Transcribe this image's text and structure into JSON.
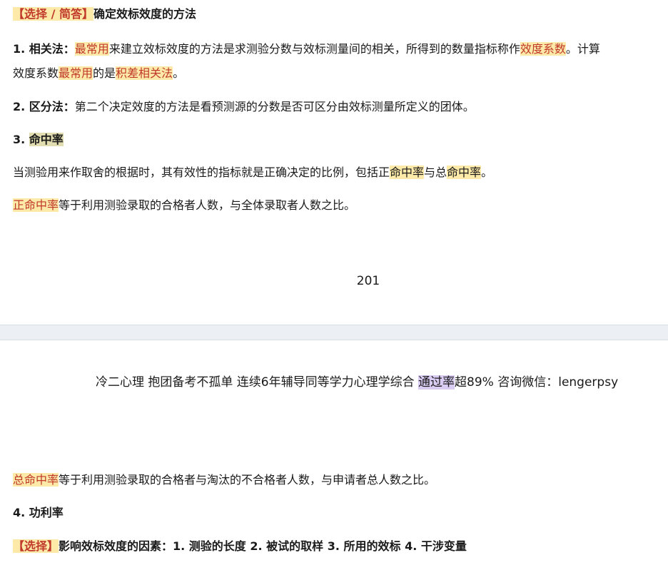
{
  "page1": {
    "line1": {
      "tag": "【选择 / 简答】",
      "title": "确定效标效度的方法"
    },
    "line2": {
      "num": "1. 相关法：",
      "hl1": "最常用",
      "t1": "来建立效标效度的方法是求测验分数与效标测量间的相关，所得到的数量指标称作",
      "hl2": "效度系数",
      "t2": "。计算"
    },
    "line3": {
      "t1": "效度系数",
      "hl1": "最常用",
      "t2": "的是",
      "hl2": "积差相关法",
      "t3": "。"
    },
    "line4": {
      "num": "2. 区分法：",
      "t1": "第二个决定效度的方法是看预测源的分数是否可区分由效标测量所定义的团体。"
    },
    "line5": {
      "num": "3. ",
      "hl": "命中率"
    },
    "line6": {
      "t1": "当测验用来作取舍的根据时，其有效性的指标就是正确决定的比例，包括正",
      "hl1": "命中率",
      "t2": "与总",
      "hl2": "命中率",
      "t3": "。"
    },
    "line7": {
      "hl": "正命中率",
      "t1": "等于利用测验录取的合格者人数，与全体录取者人数之比。"
    },
    "page_number": "201"
  },
  "page2": {
    "header": {
      "t1": "冷二心理 抱团备考不孤单 连续6年辅导同等学力心理学综合 ",
      "hl": "通过率",
      "t2": "超89% 咨询微信：lengerpsy"
    },
    "line8": {
      "hl": "总命中率",
      "t1": "等于利用测验录取的合格者与淘汰的不合格者人数，与申请者总人数之比。"
    },
    "line9": {
      "text": "4. 功利率"
    },
    "line10": {
      "tag": "【选择】",
      "text": "影响效标效度的因素：1. 测验的长度 2. 被试的取样 3. 所用的效标 4. 干涉变量"
    }
  }
}
